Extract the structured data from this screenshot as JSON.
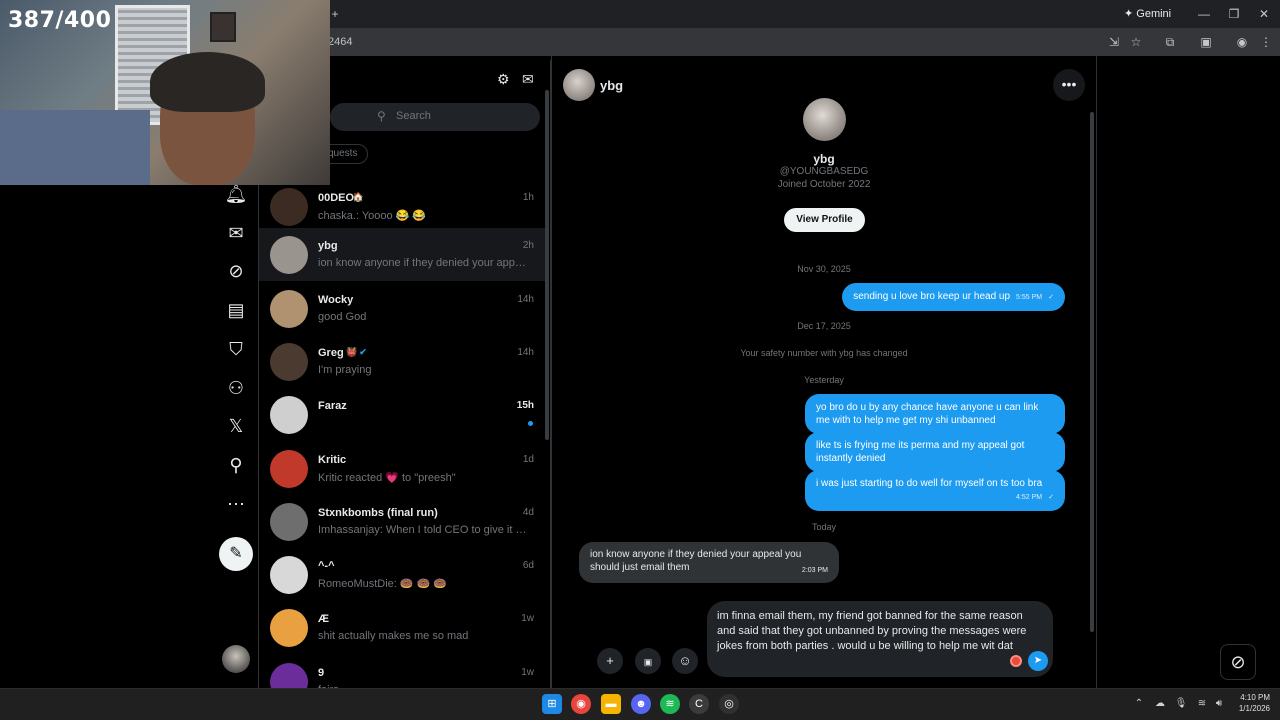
{
  "overlay": {
    "counter": "387/400"
  },
  "browser": {
    "url_fragment": "2464",
    "new_tab": "+",
    "gemini_label": "Gemini"
  },
  "nav": {
    "icons": [
      "bell-icon",
      "mail-icon",
      "grok-icon",
      "lists-icon",
      "bookmark-icon",
      "communities-icon",
      "x-logo-icon",
      "profile-icon",
      "more-icon"
    ],
    "compose": "compose-post-icon"
  },
  "list": {
    "search_placeholder": "Search",
    "requests_label": "quests",
    "conversations": [
      {
        "name": "00DEO",
        "badge": "🏠",
        "time": "1h",
        "preview": "chaska.: Yoooo 😂 😂",
        "selected": false,
        "unread": false,
        "avatar": "#3b2b22"
      },
      {
        "name": "ybg",
        "time": "2h",
        "preview": "ion know anyone if they denied your appeal ...",
        "selected": true,
        "unread": false,
        "avatar": "#9a948e"
      },
      {
        "name": "Wocky",
        "time": "14h",
        "preview": "good God",
        "selected": false,
        "unread": false,
        "avatar": "#b09270"
      },
      {
        "name": "Greg",
        "badge": "👹",
        "verified": true,
        "time": "14h",
        "preview": "I'm praying",
        "selected": false,
        "unread": false,
        "avatar": "#4a3a30"
      },
      {
        "name": "Faraz",
        "time": "15h",
        "preview": "",
        "selected": false,
        "unread": true,
        "avatar": "#cfcfcf"
      },
      {
        "name": "Kritic",
        "time": "1d",
        "preview": "Kritic reacted 💗 to \"preesh\"",
        "selected": false,
        "unread": false,
        "avatar": "#c0392b"
      },
      {
        "name": "Stxnkbombs (final run)",
        "time": "4d",
        "preview": "Imhassanjay: When I told CEO to give it up,...",
        "selected": false,
        "unread": false,
        "avatar": "#6e6e6e"
      },
      {
        "name": "^-^",
        "time": "6d",
        "preview": "RomeoMustDie: 🍩 🍩 🍩",
        "selected": false,
        "unread": false,
        "avatar": "#d8d8d8"
      },
      {
        "name": "Æ",
        "time": "1w",
        "preview": "shit actually makes me so mad",
        "selected": false,
        "unread": false,
        "avatar": "#e8a040"
      },
      {
        "name": "9",
        "time": "1w",
        "preview": "fairs",
        "selected": false,
        "unread": false,
        "avatar": "#6a2d9a"
      }
    ]
  },
  "chat": {
    "name": "ybg",
    "profile": {
      "name": "ybg",
      "handle": "@YOUNGBASEDG",
      "joined": "Joined October 2022",
      "view_profile": "View Profile"
    },
    "date1": "Nov 30, 2025",
    "msg1": {
      "text": "sending u love bro keep ur head up",
      "time": "5:55 PM"
    },
    "date2": "Dec 17, 2025",
    "safety": "Your safety number with ybg has changed",
    "date3": "Yesterday",
    "msg2": {
      "text": "yo bro do u by any chance have anyone u can link me with to help me get my shi unbanned"
    },
    "msg3": {
      "text": "like ts is frying me its perma and my appeal got instantly denied"
    },
    "msg4": {
      "text": "i was just starting to do well for myself on ts too bra",
      "time": "4:52 PM"
    },
    "date4": "Today",
    "msg5": {
      "text": "ion know anyone if they denied your appeal you should just email them",
      "time": "2:03 PM"
    },
    "composer_text": "im finna email them, my friend got banned for the same reason and said that they got unbanned by proving the messages were jokes from both parties . would u be willing to help me wit dat"
  },
  "taskbar": {
    "time": "4:10 PM",
    "date": "1/1/2026",
    "apps": [
      "windows-start-icon",
      "chrome-icon",
      "file-explorer-icon",
      "discord-icon",
      "spotify-icon",
      "ccleaner-icon",
      "obs-icon"
    ]
  }
}
